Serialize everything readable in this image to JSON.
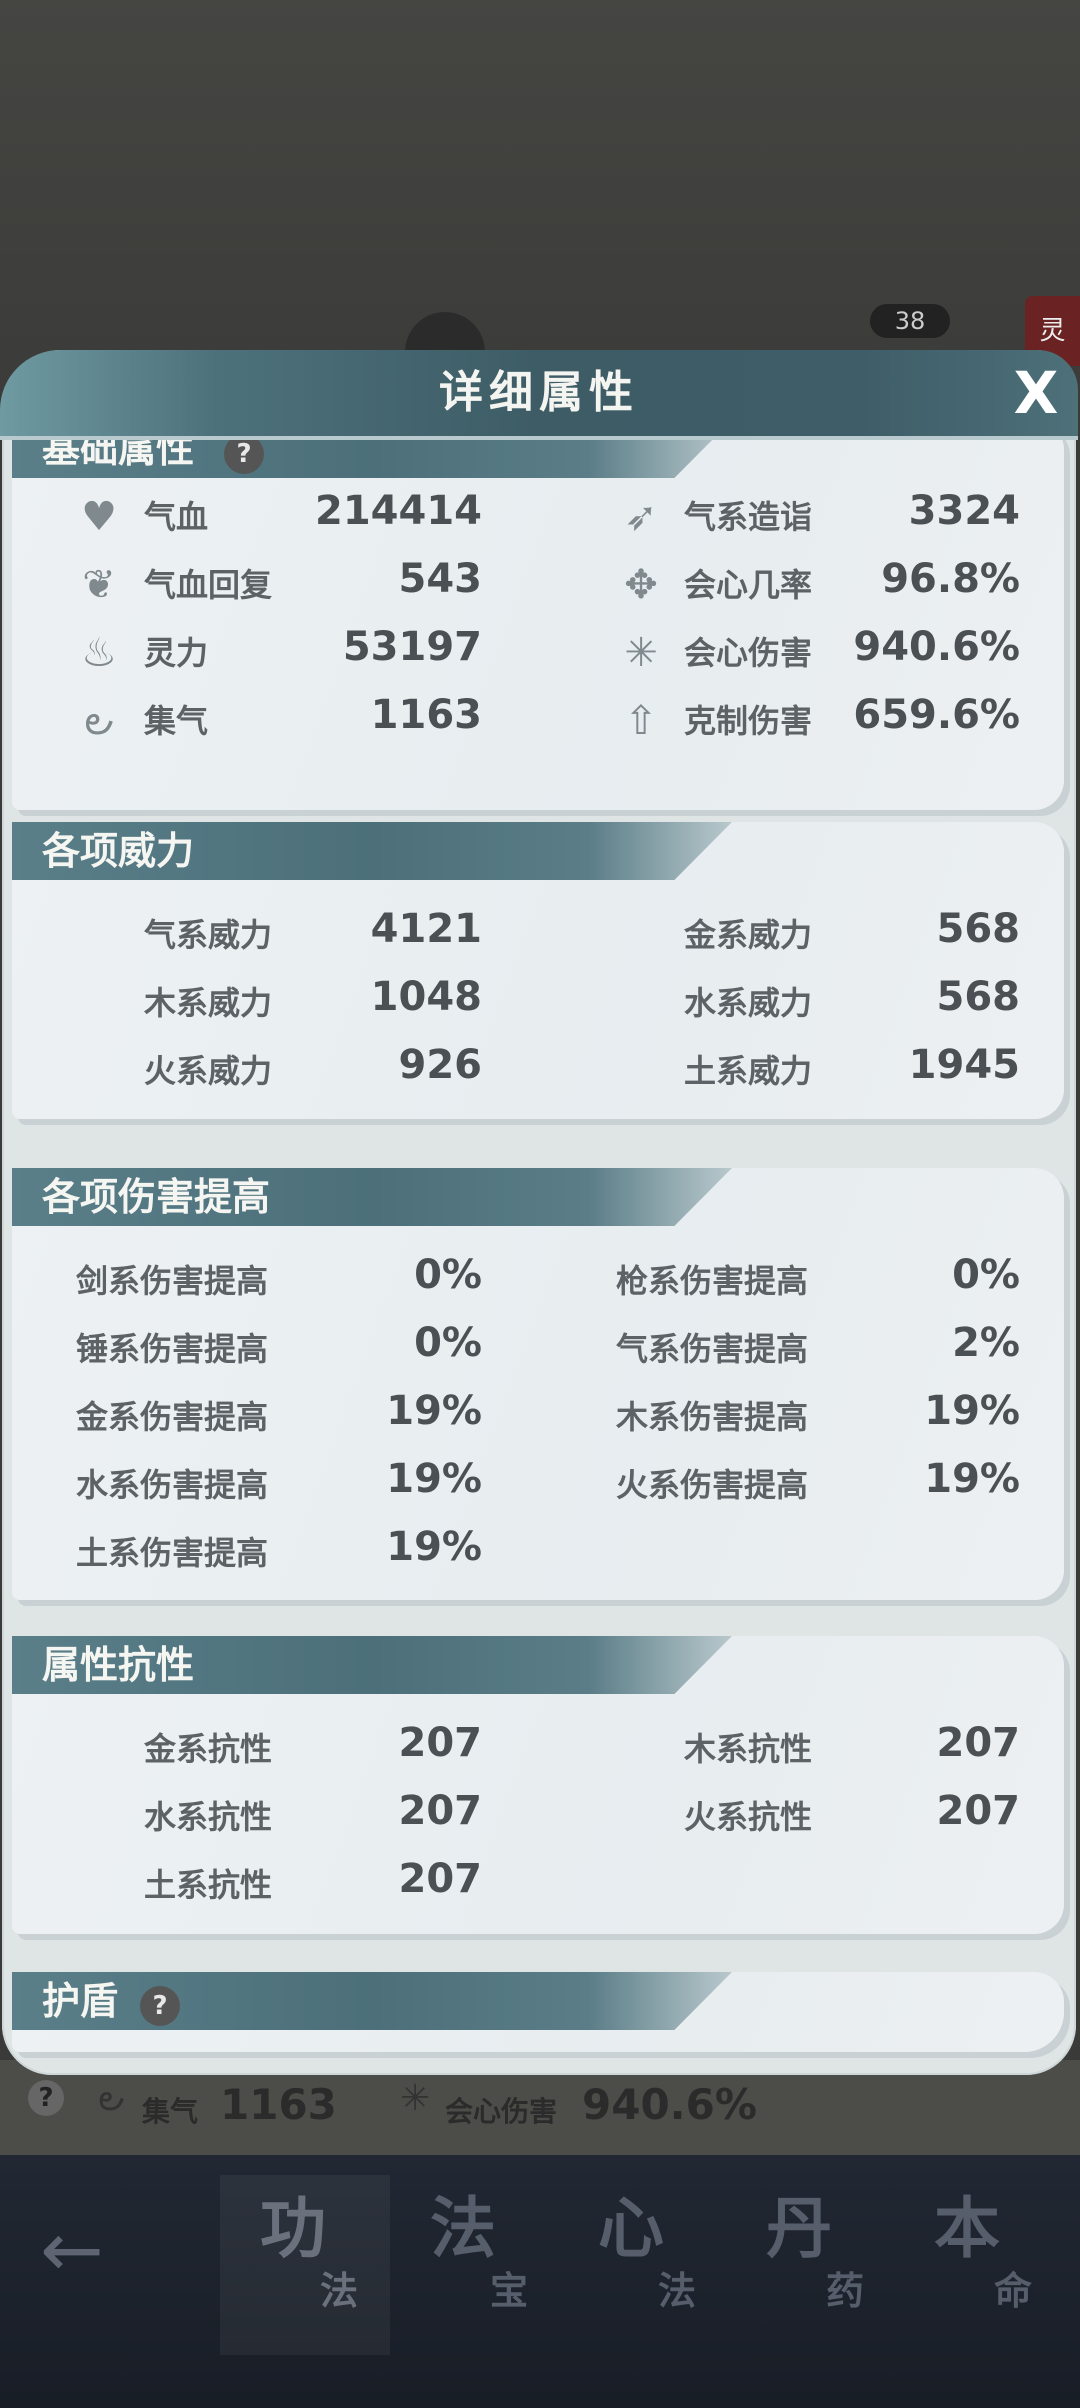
{
  "background": {
    "badge": "38",
    "side_tag": "灵",
    "strip": {
      "help": "?",
      "label1": "集气",
      "value1": "1163",
      "label2": "会心伤害",
      "value2": "940.6%"
    }
  },
  "dialog": {
    "title": "详细属性",
    "close": "X"
  },
  "basic": {
    "title": "基础属性",
    "help": "?",
    "left": [
      {
        "label": "气血",
        "value": "214414",
        "icon": "heart-icon",
        "glyph": "♥"
      },
      {
        "label": "气血回复",
        "value": "543",
        "icon": "heart-regen-icon",
        "glyph": "❦"
      },
      {
        "label": "灵力",
        "value": "53197",
        "icon": "spirit-flame-icon",
        "glyph": "♨"
      },
      {
        "label": "集气",
        "value": "1163",
        "icon": "swirl-icon",
        "glyph": "౿"
      }
    ],
    "right": [
      {
        "label": "气系造诣",
        "value": "3324",
        "icon": "wing-icon",
        "glyph": "➶"
      },
      {
        "label": "会心几率",
        "value": "96.8%",
        "icon": "crit-rate-icon",
        "glyph": "✥"
      },
      {
        "label": "会心伤害",
        "value": "940.6%",
        "icon": "burst-icon",
        "glyph": "✳"
      },
      {
        "label": "克制伤害",
        "value": "659.6%",
        "icon": "arrow-up-icon",
        "glyph": "⇧"
      }
    ]
  },
  "power": {
    "title": "各项威力",
    "left": [
      {
        "label": "气系威力",
        "value": "4121"
      },
      {
        "label": "木系威力",
        "value": "1048"
      },
      {
        "label": "火系威力",
        "value": "926"
      }
    ],
    "right": [
      {
        "label": "金系威力",
        "value": "568"
      },
      {
        "label": "水系威力",
        "value": "568"
      },
      {
        "label": "土系威力",
        "value": "1945"
      }
    ]
  },
  "damage": {
    "title": "各项伤害提高",
    "left": [
      {
        "label": "剑系伤害提高",
        "value": "0%"
      },
      {
        "label": "锤系伤害提高",
        "value": "0%"
      },
      {
        "label": "金系伤害提高",
        "value": "19%"
      },
      {
        "label": "水系伤害提高",
        "value": "19%"
      },
      {
        "label": "土系伤害提高",
        "value": "19%"
      }
    ],
    "right": [
      {
        "label": "枪系伤害提高",
        "value": "0%"
      },
      {
        "label": "气系伤害提高",
        "value": "2%"
      },
      {
        "label": "木系伤害提高",
        "value": "19%"
      },
      {
        "label": "火系伤害提高",
        "value": "19%"
      }
    ]
  },
  "resist": {
    "title": "属性抗性",
    "left": [
      {
        "label": "金系抗性",
        "value": "207"
      },
      {
        "label": "水系抗性",
        "value": "207"
      },
      {
        "label": "土系抗性",
        "value": "207"
      }
    ],
    "right": [
      {
        "label": "木系抗性",
        "value": "207"
      },
      {
        "label": "火系抗性",
        "value": "207"
      }
    ]
  },
  "shield": {
    "title": "护盾",
    "help": "?"
  },
  "nav": {
    "back": "←",
    "tabs": [
      {
        "big": "功",
        "small": "法"
      },
      {
        "big": "法",
        "small": "宝"
      },
      {
        "big": "心",
        "small": "法"
      },
      {
        "big": "丹",
        "small": "药"
      },
      {
        "big": "本",
        "small": "命"
      }
    ]
  },
  "colors": {
    "header": "#3d5c66",
    "card": "#edf1f3",
    "nav": "#1d222c"
  }
}
